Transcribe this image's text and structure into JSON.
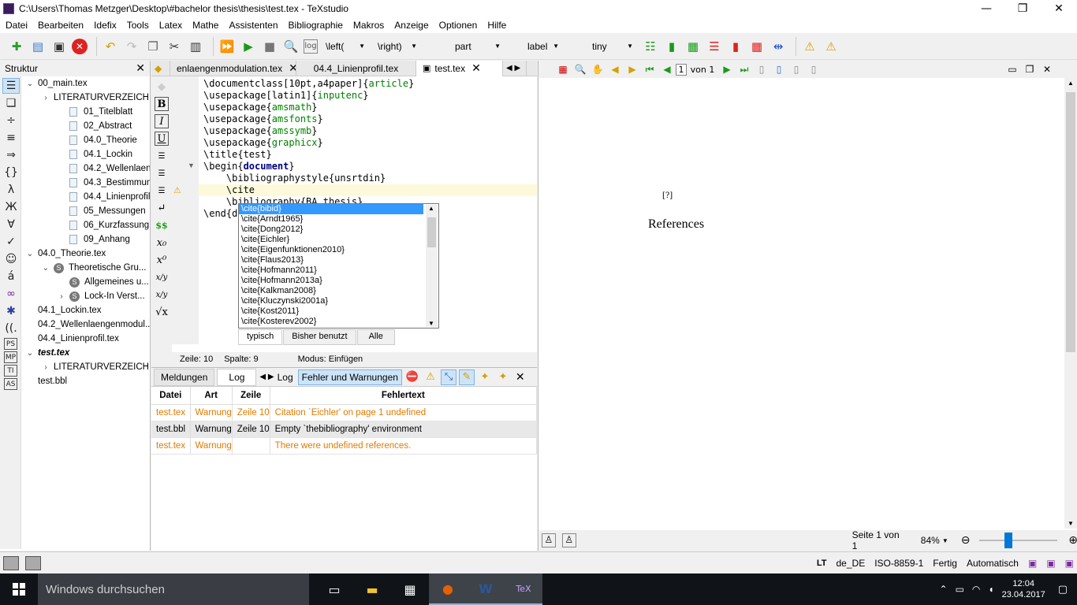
{
  "window": {
    "title": "C:\\Users\\Thomas Metzger\\Desktop\\#bachelor thesis\\thesis\\test.tex - TeXstudio",
    "minimize": "—",
    "maximize": "❐",
    "close": "✕"
  },
  "menu": [
    "Datei",
    "Bearbeiten",
    "Idefix",
    "Tools",
    "Latex",
    "Mathe",
    "Assistenten",
    "Bibliographie",
    "Makros",
    "Anzeige",
    "Optionen",
    "Hilfe"
  ],
  "toolbar": {
    "left_combo": "\\left(",
    "right_combo": "\\right)",
    "part_combo": "part",
    "label_combo": "label",
    "size_combo": "tiny"
  },
  "structure": {
    "title": "Struktur",
    "close": "✕",
    "tree": [
      {
        "level": 0,
        "tw": "⌄",
        "kind": "none",
        "label": "00_main.tex"
      },
      {
        "level": 1,
        "tw": "›",
        "kind": "none",
        "label": "LITERATURVERZEICH..."
      },
      {
        "level": 2,
        "tw": "",
        "kind": "doc",
        "label": "01_Titelblatt"
      },
      {
        "level": 2,
        "tw": "",
        "kind": "doc",
        "label": "02_Abstract"
      },
      {
        "level": 2,
        "tw": "",
        "kind": "doc",
        "label": "04.0_Theorie"
      },
      {
        "level": 2,
        "tw": "",
        "kind": "doc",
        "label": "04.1_Lockin"
      },
      {
        "level": 2,
        "tw": "",
        "kind": "doc",
        "label": "04.2_Wellenlaeng..."
      },
      {
        "level": 2,
        "tw": "",
        "kind": "doc",
        "label": "04.3_Bestimmung..."
      },
      {
        "level": 2,
        "tw": "",
        "kind": "doc",
        "label": "04.4_Linienprofil"
      },
      {
        "level": 2,
        "tw": "",
        "kind": "doc",
        "label": "05_Messungen"
      },
      {
        "level": 2,
        "tw": "",
        "kind": "doc",
        "label": "06_Kurzfassung"
      },
      {
        "level": 2,
        "tw": "",
        "kind": "doc",
        "label": "09_Anhang"
      },
      {
        "level": 0,
        "tw": "⌄",
        "kind": "none",
        "label": "04.0_Theorie.tex"
      },
      {
        "level": 1,
        "tw": "⌄",
        "kind": "sec",
        "label": "Theoretische Gru..."
      },
      {
        "level": 2,
        "tw": "",
        "kind": "sec",
        "label": "Allgemeines u..."
      },
      {
        "level": 2,
        "tw": "›",
        "kind": "sec",
        "label": "Lock-In Verst..."
      },
      {
        "level": 0,
        "tw": "",
        "kind": "none",
        "label": "04.1_Lockin.tex"
      },
      {
        "level": 0,
        "tw": "",
        "kind": "none",
        "label": "04.2_Wellenlaengenmodul..."
      },
      {
        "level": 0,
        "tw": "",
        "kind": "none",
        "label": "04.4_Linienprofil.tex"
      },
      {
        "level": 0,
        "tw": "⌄",
        "kind": "bold",
        "label": "test.tex"
      },
      {
        "level": 1,
        "tw": "›",
        "kind": "none",
        "label": "LITERATURVERZEICH..."
      },
      {
        "level": 0,
        "tw": "",
        "kind": "none",
        "label": "test.bbl"
      }
    ]
  },
  "tabs": [
    {
      "label": "enlaengenmodulation.tex",
      "close": "✕"
    },
    {
      "label": "04.4_Linienprofil.tex",
      "close": ""
    },
    {
      "label": "test.tex",
      "close": "✕"
    }
  ],
  "code": {
    "lines": [
      [
        [
          "cmd",
          "\\documentclass[10pt,a4paper]{"
        ],
        [
          "arg",
          "article"
        ],
        [
          "cmd",
          "}"
        ]
      ],
      [
        [
          "cmd",
          "\\usepackage[latin1]{"
        ],
        [
          "arg",
          "inputenc"
        ],
        [
          "cmd",
          "}"
        ]
      ],
      [
        [
          "cmd",
          "\\usepackage{"
        ],
        [
          "arg",
          "amsmath"
        ],
        [
          "cmd",
          "}"
        ]
      ],
      [
        [
          "cmd",
          "\\usepackage{"
        ],
        [
          "arg",
          "amsfonts"
        ],
        [
          "cmd",
          "}"
        ]
      ],
      [
        [
          "cmd",
          "\\usepackage{"
        ],
        [
          "arg",
          "amssymb"
        ],
        [
          "cmd",
          "}"
        ]
      ],
      [
        [
          "cmd",
          "\\usepackage{"
        ],
        [
          "arg",
          "graphicx"
        ],
        [
          "cmd",
          "}"
        ]
      ],
      [
        [
          "cmd",
          "\\title{test}"
        ]
      ],
      [
        [
          "cmd",
          "\\begin{"
        ],
        [
          "kw",
          "document"
        ],
        [
          "cmd",
          "}"
        ]
      ],
      [
        [
          "cmd",
          "    \\bibliographystyle{unsrtdin}"
        ]
      ],
      [
        [
          "cmd",
          "    \\cite"
        ]
      ],
      [
        [
          "cmd",
          "    \\bibliography{BA_thesis}"
        ]
      ],
      [
        [
          "cmd",
          "\\end{document}"
        ]
      ]
    ]
  },
  "autocomplete": {
    "items": [
      "\\cite{bibid}",
      "\\cite{Arndt1965}",
      "\\cite{Dong2012}",
      "\\cite{Eichler}",
      "\\cite{Eigenfunktionen2010}",
      "\\cite{Flaus2013}",
      "\\cite{Hofmann2011}",
      "\\cite{Hofmann2013a}",
      "\\cite{Kalkman2008}",
      "\\cite{Kluczynski2001a}",
      "\\cite{Kost2011}",
      "\\cite{Kosterev2002}"
    ],
    "tabs": [
      "typisch",
      "Bisher benutzt",
      "Alle"
    ]
  },
  "editor_status": {
    "line": "Zeile: 10",
    "col": "Spalte: 9",
    "mode": "Modus: Einfügen"
  },
  "messages": {
    "tabs": [
      "Meldungen",
      "Log"
    ],
    "log_label": "Log",
    "errors_label": "Fehler und Warnungen",
    "close": "✕",
    "columns": [
      "Datei",
      "Art",
      "Zeile",
      "Fehlertext"
    ],
    "rows": [
      {
        "file": "test.tex",
        "type": "Warnung",
        "line": "Zeile 10",
        "text": "Citation `Eichler' on page 1 undefined",
        "style": "orange"
      },
      {
        "file": "test.bbl",
        "type": "Warnung",
        "line": "Zeile 10",
        "text": "Empty `thebibliography' environment",
        "style": "hl"
      },
      {
        "file": "test.tex",
        "type": "Warnung",
        "line": "",
        "text": "There were undefined references.",
        "style": "orange"
      }
    ]
  },
  "viewer": {
    "page_input": "1",
    "page_total": "von 1",
    "refmark": "[?]",
    "references": "References",
    "page_status": "Seite 1 von 1",
    "zoom": "84%"
  },
  "status": {
    "language": "de_DE",
    "encoding": "ISO-8859-1",
    "ready": "Fertig",
    "mode": "Automatisch"
  },
  "taskbar": {
    "search_placeholder": "Windows durchsuchen",
    "time": "12:04",
    "date": "23.04.2017"
  },
  "colors": {
    "accent": "#3399ff",
    "warning": "#e07b00",
    "keyword": "#00007f",
    "argument": "#008000"
  }
}
